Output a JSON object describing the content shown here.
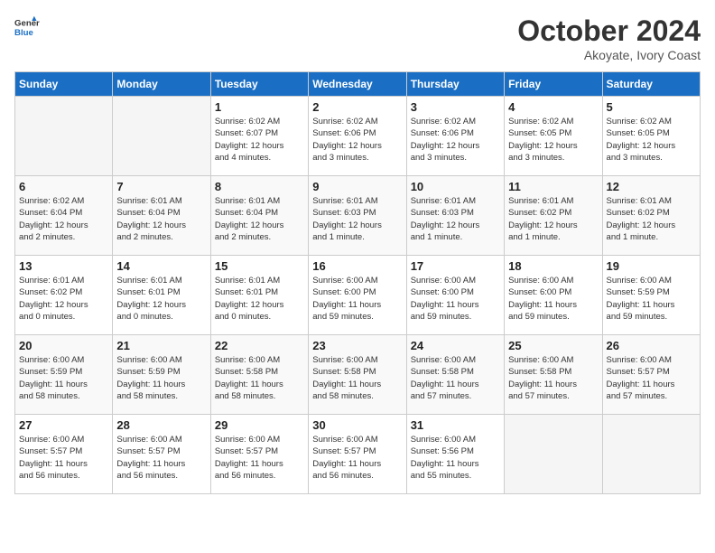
{
  "header": {
    "logo_general": "General",
    "logo_blue": "Blue",
    "month": "October 2024",
    "location": "Akoyate, Ivory Coast"
  },
  "weekdays": [
    "Sunday",
    "Monday",
    "Tuesday",
    "Wednesday",
    "Thursday",
    "Friday",
    "Saturday"
  ],
  "weeks": [
    [
      {
        "day": "",
        "empty": true
      },
      {
        "day": "",
        "empty": true
      },
      {
        "day": "1",
        "info": "Sunrise: 6:02 AM\nSunset: 6:07 PM\nDaylight: 12 hours\nand 4 minutes."
      },
      {
        "day": "2",
        "info": "Sunrise: 6:02 AM\nSunset: 6:06 PM\nDaylight: 12 hours\nand 3 minutes."
      },
      {
        "day": "3",
        "info": "Sunrise: 6:02 AM\nSunset: 6:06 PM\nDaylight: 12 hours\nand 3 minutes."
      },
      {
        "day": "4",
        "info": "Sunrise: 6:02 AM\nSunset: 6:05 PM\nDaylight: 12 hours\nand 3 minutes."
      },
      {
        "day": "5",
        "info": "Sunrise: 6:02 AM\nSunset: 6:05 PM\nDaylight: 12 hours\nand 3 minutes."
      }
    ],
    [
      {
        "day": "6",
        "info": "Sunrise: 6:02 AM\nSunset: 6:04 PM\nDaylight: 12 hours\nand 2 minutes."
      },
      {
        "day": "7",
        "info": "Sunrise: 6:01 AM\nSunset: 6:04 PM\nDaylight: 12 hours\nand 2 minutes."
      },
      {
        "day": "8",
        "info": "Sunrise: 6:01 AM\nSunset: 6:04 PM\nDaylight: 12 hours\nand 2 minutes."
      },
      {
        "day": "9",
        "info": "Sunrise: 6:01 AM\nSunset: 6:03 PM\nDaylight: 12 hours\nand 1 minute."
      },
      {
        "day": "10",
        "info": "Sunrise: 6:01 AM\nSunset: 6:03 PM\nDaylight: 12 hours\nand 1 minute."
      },
      {
        "day": "11",
        "info": "Sunrise: 6:01 AM\nSunset: 6:02 PM\nDaylight: 12 hours\nand 1 minute."
      },
      {
        "day": "12",
        "info": "Sunrise: 6:01 AM\nSunset: 6:02 PM\nDaylight: 12 hours\nand 1 minute."
      }
    ],
    [
      {
        "day": "13",
        "info": "Sunrise: 6:01 AM\nSunset: 6:02 PM\nDaylight: 12 hours\nand 0 minutes."
      },
      {
        "day": "14",
        "info": "Sunrise: 6:01 AM\nSunset: 6:01 PM\nDaylight: 12 hours\nand 0 minutes."
      },
      {
        "day": "15",
        "info": "Sunrise: 6:01 AM\nSunset: 6:01 PM\nDaylight: 12 hours\nand 0 minutes."
      },
      {
        "day": "16",
        "info": "Sunrise: 6:00 AM\nSunset: 6:00 PM\nDaylight: 11 hours\nand 59 minutes."
      },
      {
        "day": "17",
        "info": "Sunrise: 6:00 AM\nSunset: 6:00 PM\nDaylight: 11 hours\nand 59 minutes."
      },
      {
        "day": "18",
        "info": "Sunrise: 6:00 AM\nSunset: 6:00 PM\nDaylight: 11 hours\nand 59 minutes."
      },
      {
        "day": "19",
        "info": "Sunrise: 6:00 AM\nSunset: 5:59 PM\nDaylight: 11 hours\nand 59 minutes."
      }
    ],
    [
      {
        "day": "20",
        "info": "Sunrise: 6:00 AM\nSunset: 5:59 PM\nDaylight: 11 hours\nand 58 minutes."
      },
      {
        "day": "21",
        "info": "Sunrise: 6:00 AM\nSunset: 5:59 PM\nDaylight: 11 hours\nand 58 minutes."
      },
      {
        "day": "22",
        "info": "Sunrise: 6:00 AM\nSunset: 5:58 PM\nDaylight: 11 hours\nand 58 minutes."
      },
      {
        "day": "23",
        "info": "Sunrise: 6:00 AM\nSunset: 5:58 PM\nDaylight: 11 hours\nand 58 minutes."
      },
      {
        "day": "24",
        "info": "Sunrise: 6:00 AM\nSunset: 5:58 PM\nDaylight: 11 hours\nand 57 minutes."
      },
      {
        "day": "25",
        "info": "Sunrise: 6:00 AM\nSunset: 5:58 PM\nDaylight: 11 hours\nand 57 minutes."
      },
      {
        "day": "26",
        "info": "Sunrise: 6:00 AM\nSunset: 5:57 PM\nDaylight: 11 hours\nand 57 minutes."
      }
    ],
    [
      {
        "day": "27",
        "info": "Sunrise: 6:00 AM\nSunset: 5:57 PM\nDaylight: 11 hours\nand 56 minutes."
      },
      {
        "day": "28",
        "info": "Sunrise: 6:00 AM\nSunset: 5:57 PM\nDaylight: 11 hours\nand 56 minutes."
      },
      {
        "day": "29",
        "info": "Sunrise: 6:00 AM\nSunset: 5:57 PM\nDaylight: 11 hours\nand 56 minutes."
      },
      {
        "day": "30",
        "info": "Sunrise: 6:00 AM\nSunset: 5:57 PM\nDaylight: 11 hours\nand 56 minutes."
      },
      {
        "day": "31",
        "info": "Sunrise: 6:00 AM\nSunset: 5:56 PM\nDaylight: 11 hours\nand 55 minutes."
      },
      {
        "day": "",
        "empty": true
      },
      {
        "day": "",
        "empty": true
      }
    ]
  ]
}
